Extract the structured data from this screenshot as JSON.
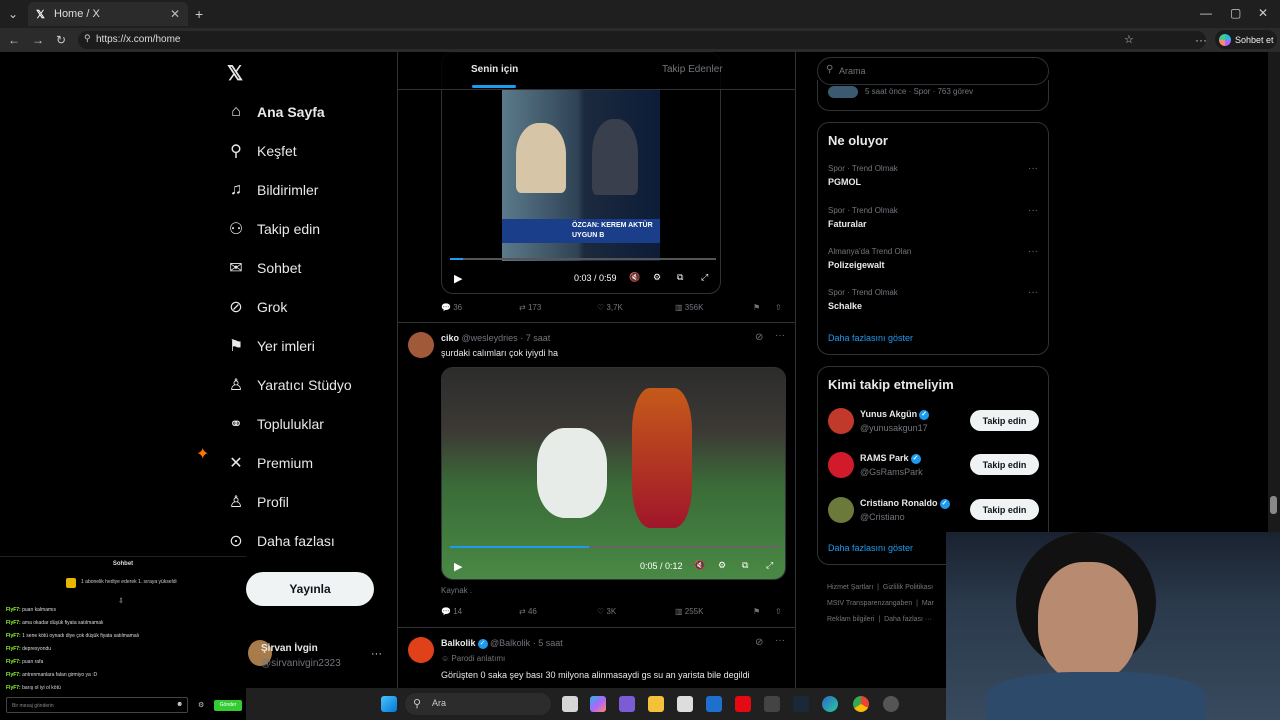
{
  "browser": {
    "tab_title": "Home / X",
    "url": "https://x.com/home",
    "copilot_label": "Sohbet et"
  },
  "nav": {
    "items": [
      {
        "label": "Ana Sayfa",
        "icon": "home-icon"
      },
      {
        "label": "Keşfet",
        "icon": "search-icon"
      },
      {
        "label": "Bildirimler",
        "icon": "bell-icon"
      },
      {
        "label": "Takip edin",
        "icon": "add-user-icon"
      },
      {
        "label": "Sohbet",
        "icon": "mail-icon"
      },
      {
        "label": "Grok",
        "icon": "grok-icon"
      },
      {
        "label": "Yer imleri",
        "icon": "bookmark-icon"
      },
      {
        "label": "Yaratıcı Stüdyo",
        "icon": "studio-icon"
      },
      {
        "label": "Topluluklar",
        "icon": "communities-icon"
      },
      {
        "label": "Premium",
        "icon": "x-logo-icon"
      },
      {
        "label": "Profil",
        "icon": "profile-icon"
      },
      {
        "label": "Daha fazlası",
        "icon": "more-circle-icon"
      }
    ],
    "post_button": "Yayınla",
    "account_name": "Şirvan İvgin",
    "account_handle": "@sirvanivgin2323"
  },
  "feed": {
    "tabs": [
      "Senin için",
      "Takip Edenler"
    ],
    "posts": [
      {
        "video_overlay_text": "ÖZCAN: KEREM AKTÜR UYGUN B",
        "video_time": "0:03 / 0:59",
        "video_progress": 0.05,
        "replies": "36",
        "reposts": "173",
        "likes": "3,7K",
        "views": "356K"
      },
      {
        "name": "ciko",
        "handle": "@wesleydries",
        "time": "· 7 saat",
        "text": "şurdaki calımları çok iyiydi ha",
        "video_time": "0:05 / 0:12",
        "video_progress": 0.42,
        "caption": "Kaynak .",
        "replies": "14",
        "reposts": "46",
        "likes": "3K",
        "views": "255K"
      },
      {
        "name": "Balkolik",
        "handle": "@Balkolik",
        "time": "· 5 saat",
        "label": "Parodi anlatımı",
        "text": "Görüşten 0 saka şey bası 30 milyona alinmasaydi gs su an yarista bile degildi"
      }
    ]
  },
  "sidebar": {
    "search_placeholder": "Arama",
    "top_snippet": "5 saat önce · Spor · 763 görev",
    "trends_title": "Ne oluyor",
    "trends": [
      {
        "meta": "Spor · Trend Olmak",
        "name": "PGMOL"
      },
      {
        "meta": "Spor · Trend Olmak",
        "name": "Faturalar"
      },
      {
        "meta": "Almanya'da Trend Olan",
        "name": "Polizeigewalt"
      },
      {
        "meta": "Spor · Trend Olmak",
        "name": "Schalke"
      }
    ],
    "show_more": "Daha fazlasını göster",
    "wtf_title": "Kimi takip etmeliyim",
    "wtf": [
      {
        "name": "Yunus Akgün",
        "handle": "@yunusakgun17"
      },
      {
        "name": "RAMS Park",
        "handle": "@GsRamsPark"
      },
      {
        "name": "Cristiano Ronaldo",
        "handle": "@Cristiano"
      }
    ],
    "follow_label": "Takip edin",
    "footer": [
      "Hizmet Şartları",
      "Gizlilik Politikası",
      "MStV Transparenzangaben",
      "Reklam bilgileri",
      "Daha fazlası ···",
      "Mar"
    ]
  },
  "chat": {
    "title": "Sohbet",
    "gift": "1 abonelik hediye ederek 1. sıraya yükseldi",
    "messages": [
      {
        "user": "FlyF7:",
        "text": "puan kalmamıs"
      },
      {
        "user": "FlyF7:",
        "text": "ama okadar düşük fiyata satılmamalı"
      },
      {
        "user": "FlyF7:",
        "text": "1 sene kötü oynadı diye çok düşük fiyata satılmamalı"
      },
      {
        "user": "FlyF7:",
        "text": "depresyondu"
      },
      {
        "user": "FlyF7:",
        "text": "puan rafa"
      },
      {
        "user": "FlyF7:",
        "text": "antrenmanlara falan girmiyo ya :D"
      },
      {
        "user": "FlyF7:",
        "text": "barış ol iyi ol kötü"
      }
    ],
    "input_placeholder": "Bir mesaj gönderin",
    "send_label": "Gönder"
  },
  "taskbar": {
    "search_label": "Ara"
  },
  "colors": {
    "accent": "#1d9bf0",
    "background": "#000000",
    "border": "#2f3336"
  }
}
